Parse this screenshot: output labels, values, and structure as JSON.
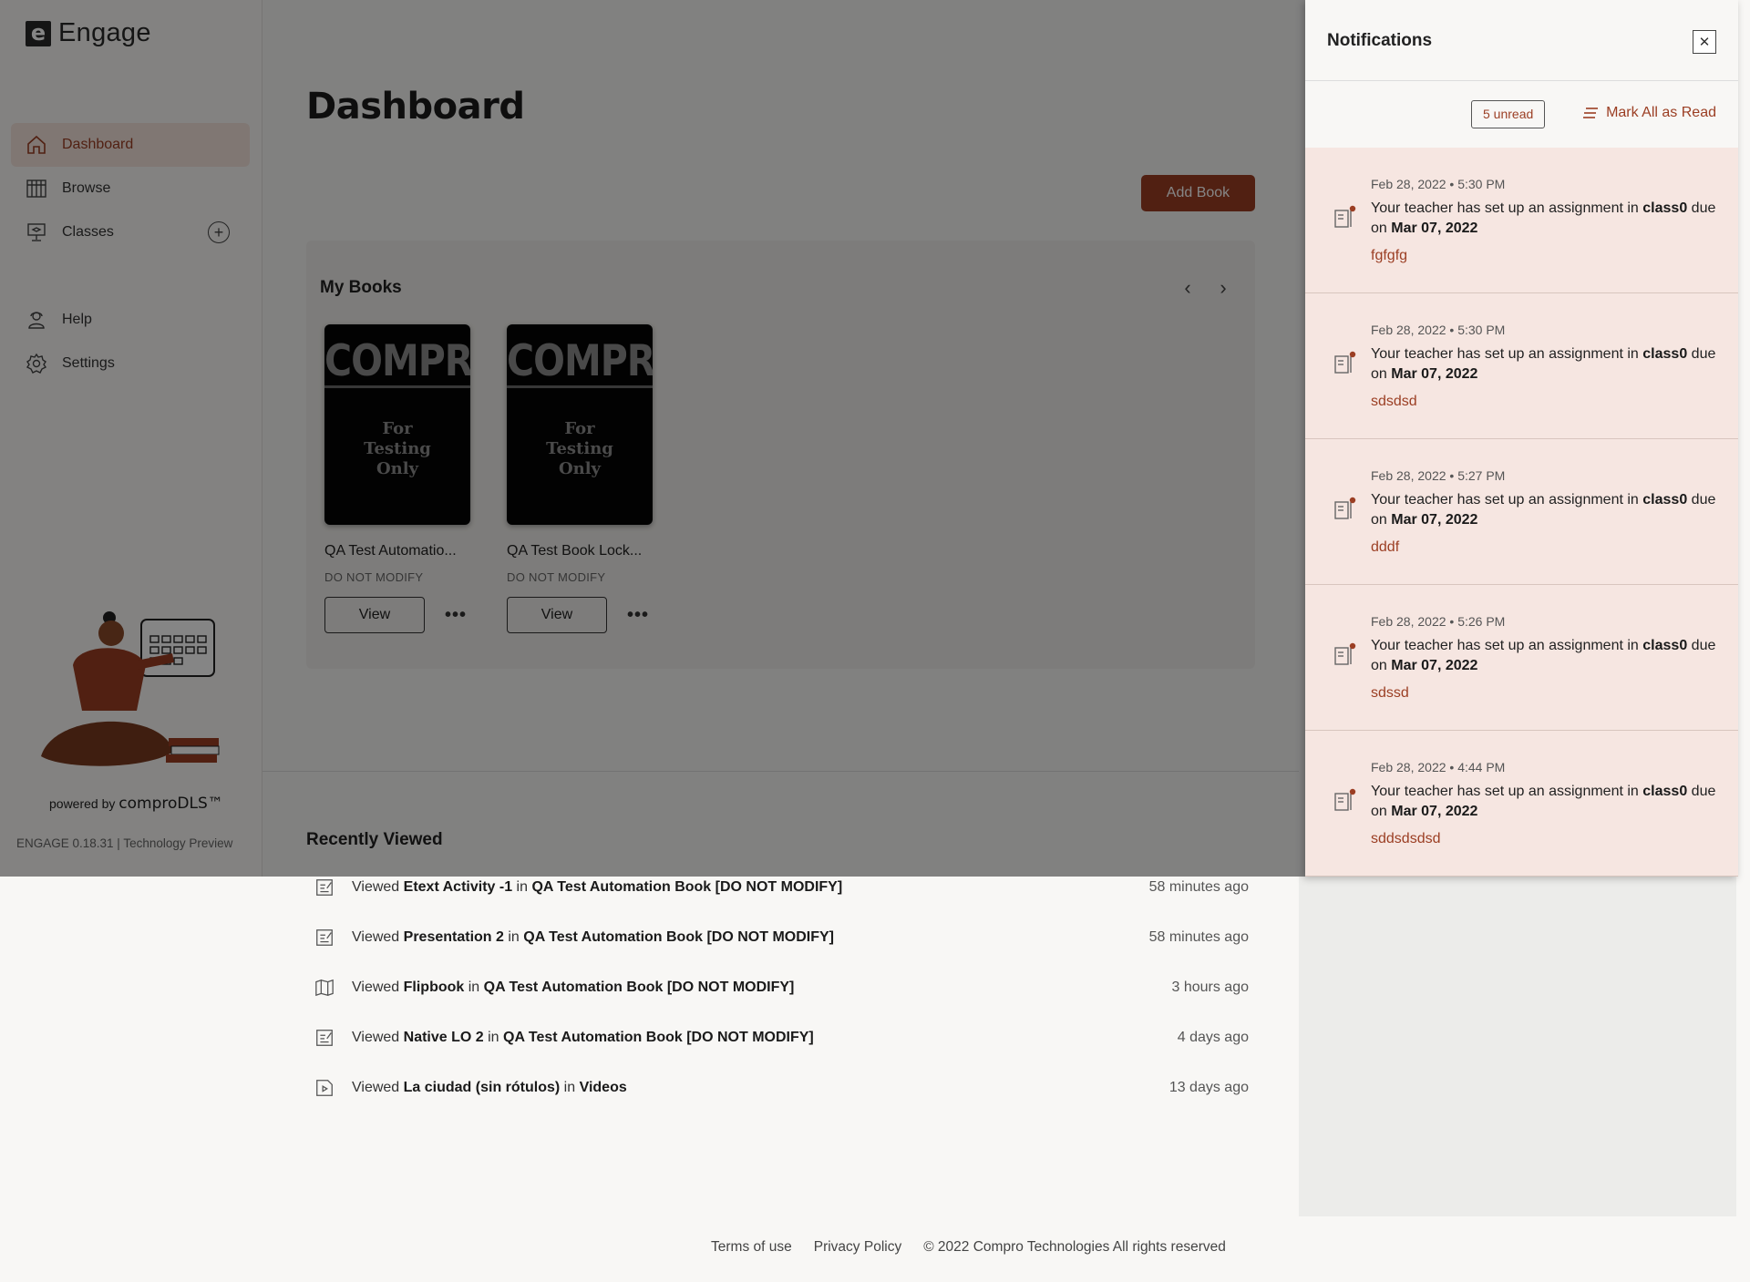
{
  "app": {
    "name": "Engage",
    "logo_letter": "e"
  },
  "sidebar": {
    "items": [
      {
        "label": "Dashboard",
        "icon": "home-icon",
        "active": true
      },
      {
        "label": "Browse",
        "icon": "library-icon"
      },
      {
        "label": "Classes",
        "icon": "classroom-icon"
      },
      {
        "label": "Help",
        "icon": "help-person-icon"
      },
      {
        "label": "Settings",
        "icon": "gear-icon"
      }
    ],
    "powered_by": "powered by",
    "powered_brand": "comproDLS™",
    "version": "ENGAGE 0.18.31 | Technology Preview"
  },
  "main": {
    "title": "Dashboard",
    "add_book_label": "Add Book",
    "my_books": {
      "title": "My Books",
      "books": [
        {
          "cover_brand": "COMPRO",
          "cover_line1": "For",
          "cover_line2": "Testing",
          "cover_line3": "Only",
          "title": "QA Test Automatio...",
          "subtitle": "DO NOT MODIFY",
          "view_label": "View"
        },
        {
          "cover_brand": "COMPRO",
          "cover_line1": "For",
          "cover_line2": "Testing",
          "cover_line3": "Only",
          "title": "QA Test Book Lock...",
          "subtitle": "DO NOT MODIFY",
          "view_label": "View"
        }
      ]
    },
    "recently_viewed": {
      "title": "Recently Viewed",
      "items": [
        {
          "icon": "activity-icon",
          "prefix": "Viewed",
          "item": "Etext Activity -1",
          "in": "in",
          "book": "QA Test Automation Book [DO NOT MODIFY]",
          "time": "58 minutes ago"
        },
        {
          "icon": "activity-icon",
          "prefix": "Viewed",
          "item": "Presentation 2",
          "in": "in",
          "book": "QA Test Automation Book [DO NOT MODIFY]",
          "time": "58 minutes ago"
        },
        {
          "icon": "flipbook-icon",
          "prefix": "Viewed",
          "item": "Flipbook",
          "in": "in",
          "book": "QA Test Automation Book [DO NOT MODIFY]",
          "time": "3 hours ago"
        },
        {
          "icon": "activity-icon",
          "prefix": "Viewed",
          "item": "Native LO 2",
          "in": "in",
          "book": "QA Test Automation Book [DO NOT MODIFY]",
          "time": "4 days ago"
        },
        {
          "icon": "video-icon",
          "prefix": "Viewed",
          "item": "La ciudad (sin rótulos)",
          "in": "in",
          "book": "Videos",
          "time": "13 days ago"
        }
      ]
    }
  },
  "footer": {
    "terms": "Terms of use",
    "privacy": "Privacy Policy",
    "copyright": "© 2022 Compro Technologies All rights reserved"
  },
  "notifications": {
    "title": "Notifications",
    "unread_label": "5 unread",
    "mark_all_label": "Mark All as Read",
    "items": [
      {
        "date": "Feb 28, 2022 • 5:30 PM",
        "msg_a": "Your teacher has set up an assignment in",
        "class": "class0",
        "msg_b": "due on",
        "due": "Mar 07, 2022",
        "link": "fgfgfg"
      },
      {
        "date": "Feb 28, 2022 • 5:30 PM",
        "msg_a": "Your teacher has set up an assignment in",
        "class": "class0",
        "msg_b": "due on",
        "due": "Mar 07, 2022",
        "link": "sdsdsd"
      },
      {
        "date": "Feb 28, 2022 • 5:27 PM",
        "msg_a": "Your teacher has set up an assignment in",
        "class": "class0",
        "msg_b": "due on",
        "due": "Mar 07, 2022",
        "link": "dddf"
      },
      {
        "date": "Feb 28, 2022 • 5:26 PM",
        "msg_a": "Your teacher has set up an assignment in",
        "class": "class0",
        "msg_b": "due on",
        "due": "Mar 07, 2022",
        "link": "sdssd"
      },
      {
        "date": "Feb 28, 2022 • 4:44 PM",
        "msg_a": "Your teacher has set up an assignment in",
        "class": "class0",
        "msg_b": "due on",
        "due": "Mar 07, 2022",
        "link": "sddsdsdsd"
      }
    ]
  },
  "colors": {
    "accent": "#9b3e23",
    "notif_bg": "#f6e6e1"
  }
}
